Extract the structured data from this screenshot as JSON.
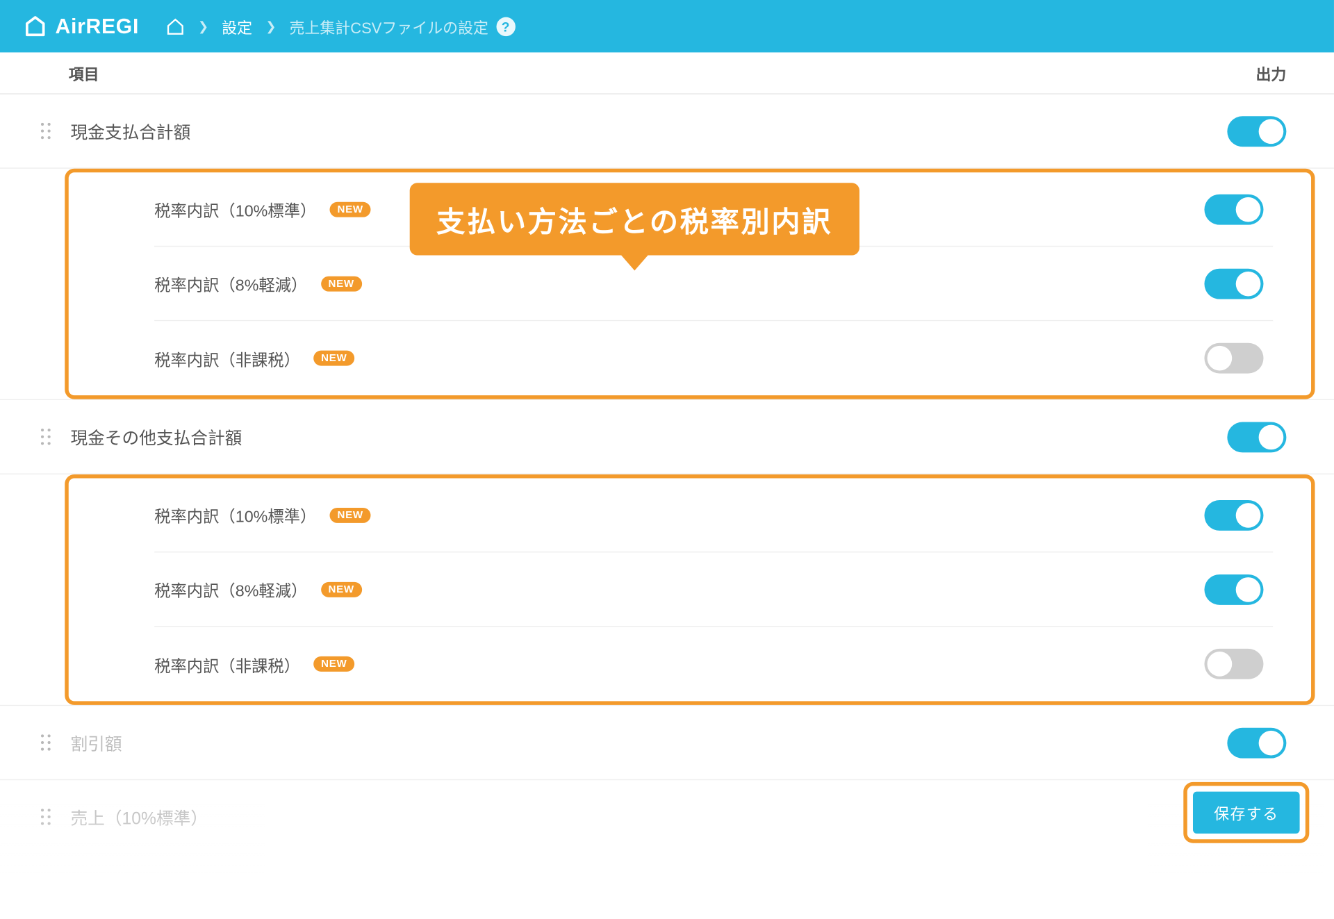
{
  "brand": "AirREGI",
  "breadcrumb": {
    "settings": "設定",
    "page": "売上集計CSVファイルの設定"
  },
  "columns": {
    "item": "項目",
    "output": "出力"
  },
  "callout": "支払い方法ごとの税率別内訳",
  "badge_new": "NEW",
  "rows": {
    "cash_total": "現金支払合計額",
    "other_cash_total": "現金その他支払合計額",
    "discount": "割引額",
    "sales_10": "売上（10%標準）"
  },
  "sub": {
    "rate_10": "税率内訳（10%標準）",
    "rate_8": "税率内訳（8%軽減）",
    "non_tax": "税率内訳（非課税）"
  },
  "save_label": "保存する"
}
